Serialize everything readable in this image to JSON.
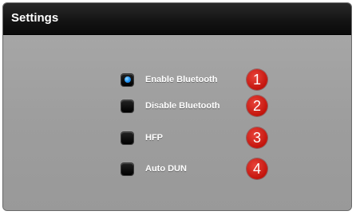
{
  "header": {
    "title": "Settings"
  },
  "options": [
    {
      "label": "Enable Bluetooth",
      "selected": true,
      "badge": "1"
    },
    {
      "label": "Disable Bluetooth",
      "selected": false,
      "badge": "2"
    },
    {
      "label": "HFP",
      "selected": false,
      "badge": "3"
    },
    {
      "label": "Auto DUN",
      "selected": false,
      "badge": "4"
    }
  ],
  "colors": {
    "header_bg": "#141414",
    "content_bg": "#9d9d9d",
    "radio_selected": "#1e8ff0",
    "badge": "#c3140c"
  }
}
